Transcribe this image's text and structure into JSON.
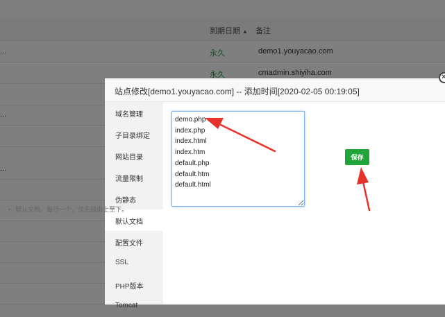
{
  "table": {
    "col_expire": "到期日期",
    "col_note": "备注",
    "rows": [
      {
        "prefix": "...",
        "expire": "永久",
        "note": "demo1.youyacao.com"
      },
      {
        "prefix": "",
        "expire": "永久",
        "note": "cmadmin.shiyiha.com"
      }
    ],
    "row_ellipsis": "..."
  },
  "modal": {
    "title": "站点修改[demo1.youyacao.com] -- 添加时间[2020-02-05 00:19:05]",
    "close_glyph": "×",
    "sidebar": [
      "域名管理",
      "子目录绑定",
      "网站目录",
      "流量限制",
      "伪静态",
      "默认文档",
      "配置文件",
      "SSL",
      "PHP版本",
      "Tomcat"
    ],
    "active_index": 5,
    "default_docs": "demo.php\nindex.php\nindex.html\nindex.htm\ndefault.php\ndefault.htm\ndefault.html",
    "save_label": "保存",
    "tip_bullet": "•",
    "tip": "默认文档，每行一个，优先级由上至下。"
  },
  "colors": {
    "accent": "#20a53a",
    "arrow": "#e8322c"
  }
}
